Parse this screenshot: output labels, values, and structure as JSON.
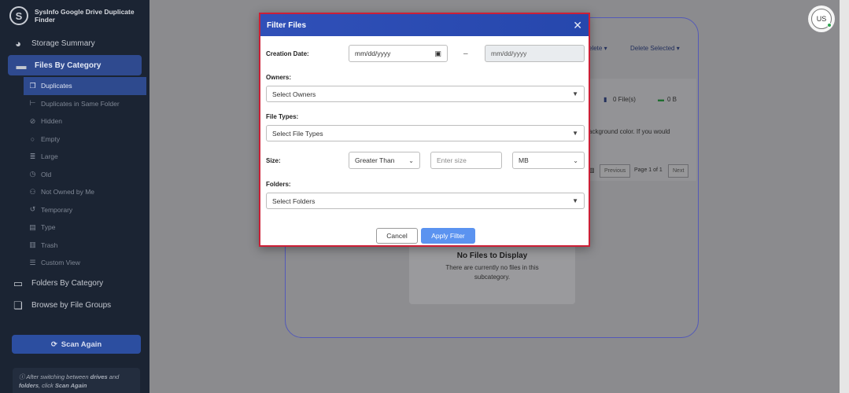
{
  "app": {
    "title": "SysInfo Google Drive Duplicate Finder",
    "logo_letter": "S"
  },
  "sidebar": {
    "items": [
      {
        "label": "Storage Summary",
        "icon": "pie-chart-icon",
        "glyph": "◕"
      },
      {
        "label": "Files By Category",
        "icon": "folder-icon",
        "glyph": "▬"
      }
    ],
    "sub_items": [
      {
        "label": "Duplicates",
        "icon": "copy-icon",
        "glyph": "❐"
      },
      {
        "label": "Duplicates in Same Folder",
        "icon": "tree-icon",
        "glyph": "⊢"
      },
      {
        "label": "Hidden",
        "icon": "eye-slash-icon",
        "glyph": "⊘"
      },
      {
        "label": "Empty",
        "icon": "circle-icon",
        "glyph": "○"
      },
      {
        "label": "Large",
        "icon": "database-icon",
        "glyph": "≣"
      },
      {
        "label": "Old",
        "icon": "clock-icon",
        "glyph": "◷"
      },
      {
        "label": "Not Owned by Me",
        "icon": "user-x-icon",
        "glyph": "⚇"
      },
      {
        "label": "Temporary",
        "icon": "history-icon",
        "glyph": "↺"
      },
      {
        "label": "Type",
        "icon": "file-icon",
        "glyph": "▤"
      },
      {
        "label": "Trash",
        "icon": "trash-icon",
        "glyph": "▥"
      },
      {
        "label": "Custom View",
        "icon": "list-icon",
        "glyph": "☰"
      }
    ],
    "bottom_items": [
      {
        "label": "Folders By Category",
        "icon": "folder-open-icon",
        "glyph": "▭"
      },
      {
        "label": "Browse by File Groups",
        "icon": "layers-icon",
        "glyph": "❏"
      }
    ],
    "scan_button": "Scan Again",
    "tip_part1": "After switching between ",
    "tip_drives": "drives",
    "tip_part2": " and ",
    "tip_folders": "folders",
    "tip_part3": ", click ",
    "tip_scan": "Scan Again"
  },
  "background": {
    "delete_label": "elete ▾",
    "delete_selected": "Delete Selected ▾",
    "files_count": "0 File(s)",
    "files_size": "0 B",
    "info_text_line1": "ackground color. If you would",
    "pager_prev": "Previous",
    "pager_page": "Page 1 of 1",
    "pager_next": "Next",
    "empty_title": "No Files to Display",
    "empty_sub": "There are currently no files in this subcategory."
  },
  "user": {
    "initials": "US"
  },
  "modal": {
    "title": "Filter Files",
    "creation_date_label": "Creation Date:",
    "date_from_placeholder": "mm/dd/yyyy",
    "date_separator": "–",
    "date_to_placeholder": "mm/dd/yyyy",
    "owners_label": "Owners:",
    "owners_placeholder": "Select Owners",
    "file_types_label": "File Types:",
    "file_types_placeholder": "Select File Types",
    "size_label": "Size:",
    "size_comparator": "Greater Than",
    "size_placeholder": "Enter size",
    "size_unit": "MB",
    "folders_label": "Folders:",
    "folders_placeholder": "Select Folders",
    "cancel_button": "Cancel",
    "apply_button": "Apply Filter"
  },
  "colors": {
    "sidebar_bg": "#1b2433",
    "active_nav": "#2f4a8f",
    "modal_header": "#3050b8",
    "highlight_border": "#cc1f36",
    "apply_button": "#5b93f0"
  }
}
